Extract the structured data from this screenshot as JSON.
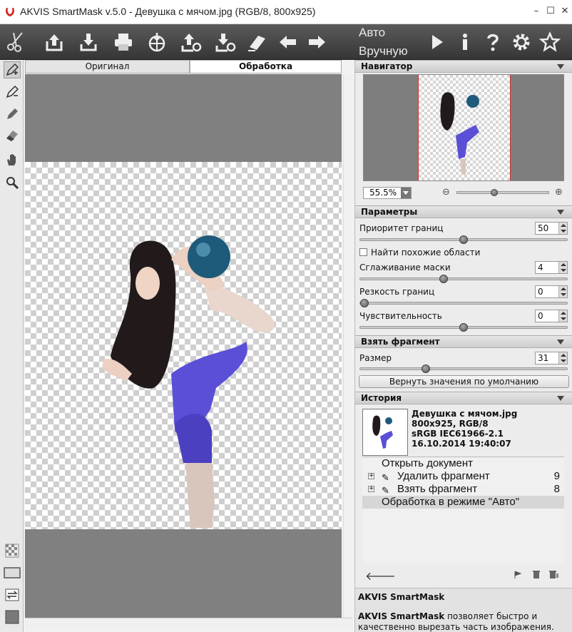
{
  "app": {
    "title": "AKVIS SmartMask v.5.0 - Девушка с мячом.jpg (RGB/8, 800x925)",
    "window_controls": {
      "minimize": "–",
      "maximize": "☐",
      "close": "✕"
    }
  },
  "toolbar": {
    "icons": [
      "scissors-icon",
      "open-icon",
      "save-icon",
      "print-icon",
      "publish-icon",
      "import-icon",
      "export-icon",
      "eraser-icon",
      "undo-icon",
      "redo-icon",
      "run-icon",
      "info-icon",
      "help-icon",
      "settings-icon",
      "favorite-icon"
    ],
    "mode_auto": "Авто",
    "mode_manual": "Вручную"
  },
  "tabs": {
    "original": "Оригинал",
    "processing": "Обработка"
  },
  "left_tools": [
    "keep-pencil-icon",
    "remove-pencil-icon",
    "marker-icon",
    "eraser-tool-icon",
    "hand-icon",
    "zoom-icon",
    "checker-icon",
    "frame-icon",
    "swap-icon",
    "color-swatch-icon"
  ],
  "navigator": {
    "title": "Навигатор",
    "zoom": "55.5%",
    "zoom_minus": "⊖",
    "zoom_plus": "⊕",
    "zoom_slider_level": 0.4
  },
  "params": {
    "title": "Параметры",
    "edge_priority": {
      "label": "Приоритет границ",
      "value": "50",
      "level": 0.5
    },
    "find_similar": {
      "label": "Найти похожие области",
      "checked": false
    },
    "mask_smoothing": {
      "label": "Сглаживание маски",
      "value": "4",
      "level": 0.4
    },
    "edge_sharpness": {
      "label": "Резкость границ",
      "value": "0",
      "level": 0.0
    },
    "sensitivity": {
      "label": "Чувствительность",
      "value": "0",
      "level": 0.5
    }
  },
  "fragment": {
    "title": "Взять фрагмент",
    "size_label": "Размер",
    "size_value": "31",
    "size_level": 0.31,
    "reset_button": "Вернуть значения по умолчанию"
  },
  "history": {
    "title": "История",
    "file_name": "Девушка с мячом.jpg",
    "file_info": "800x925, RGB/8",
    "profile": "sRGB IEC61966-2.1",
    "datetime": "16.10.2014 19:40:07",
    "items": [
      {
        "label": "Открыть документ",
        "count": "",
        "expandable": false
      },
      {
        "label": "Удалить фрагмент",
        "count": "9",
        "expandable": true
      },
      {
        "label": "Взять фрагмент",
        "count": "8",
        "expandable": true
      },
      {
        "label": "Обработка в режиме \"Авто\"",
        "count": "",
        "expandable": false,
        "selected": true
      }
    ]
  },
  "info": {
    "title": "AKVIS SmartMask",
    "text_bold": "AKVIS SmartMask",
    "text": " позволяет быстро и качественно вырезать часть изображения."
  },
  "colors": {
    "toolbar_bg": "#3f3f3f",
    "canvas_bg": "#808080",
    "leotard": "#5a4fd6",
    "ball": "#1e5a7a"
  }
}
